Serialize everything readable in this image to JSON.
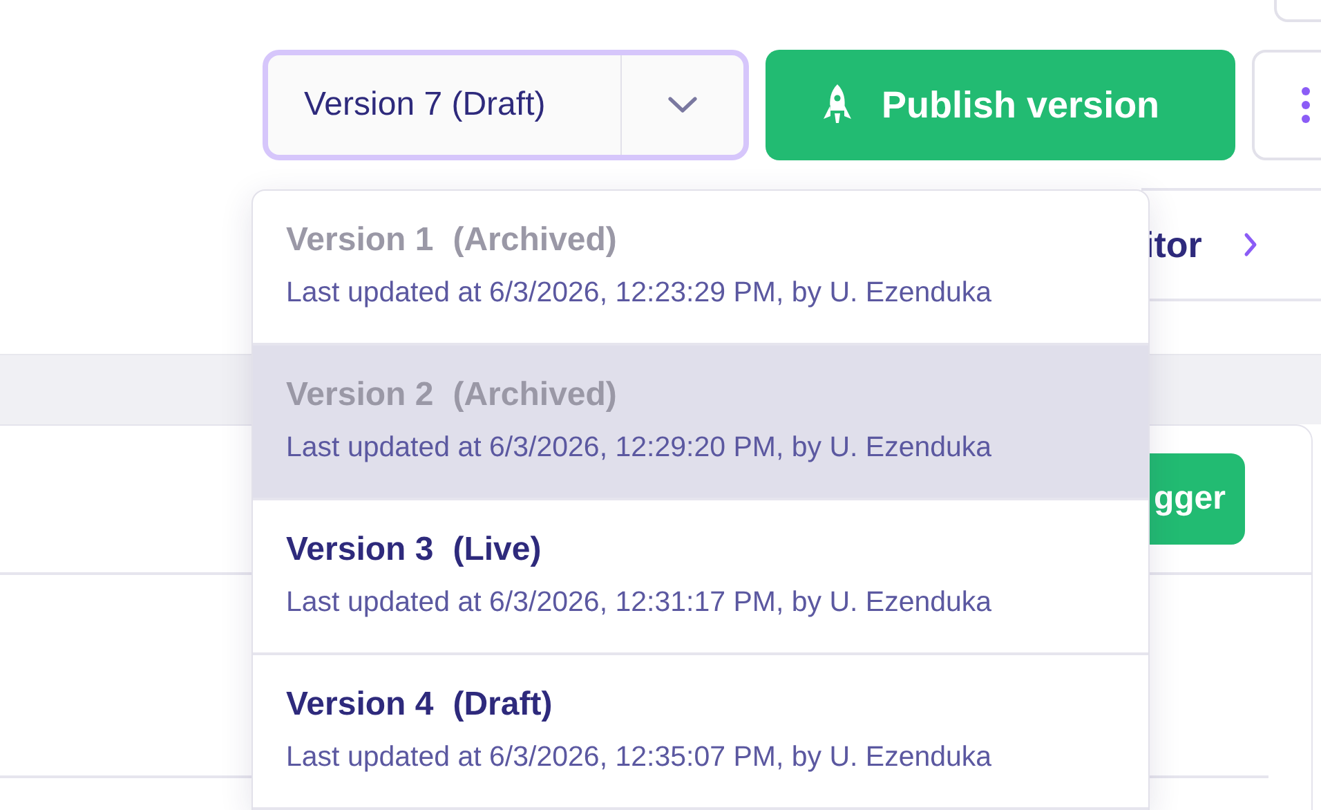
{
  "version_select": {
    "value": "Version 7 (Draft)",
    "focused": true
  },
  "publish_button": {
    "label": "Publish version"
  },
  "editor_link": {
    "label": "itor"
  },
  "trigger_button": {
    "label": "gger"
  },
  "version_menu": [
    {
      "title": "Version 1",
      "status": "(Archived)",
      "kind": "archived",
      "updated": "Last updated at 6/3/2026, 12:23:29 PM, by U. Ezenduka",
      "selected": false
    },
    {
      "title": "Version 2",
      "status": "(Archived)",
      "kind": "archived",
      "updated": "Last updated at 6/3/2026, 12:29:20 PM, by U. Ezenduka",
      "selected": true
    },
    {
      "title": "Version 3",
      "status": "(Live)",
      "kind": "live",
      "updated": "Last updated at 6/3/2026, 12:31:17 PM, by U. Ezenduka",
      "selected": false
    },
    {
      "title": "Version 4",
      "status": "(Draft)",
      "kind": "draft",
      "updated": "Last updated at 6/3/2026, 12:35:07 PM, by U. Ezenduka",
      "selected": false
    }
  ]
}
